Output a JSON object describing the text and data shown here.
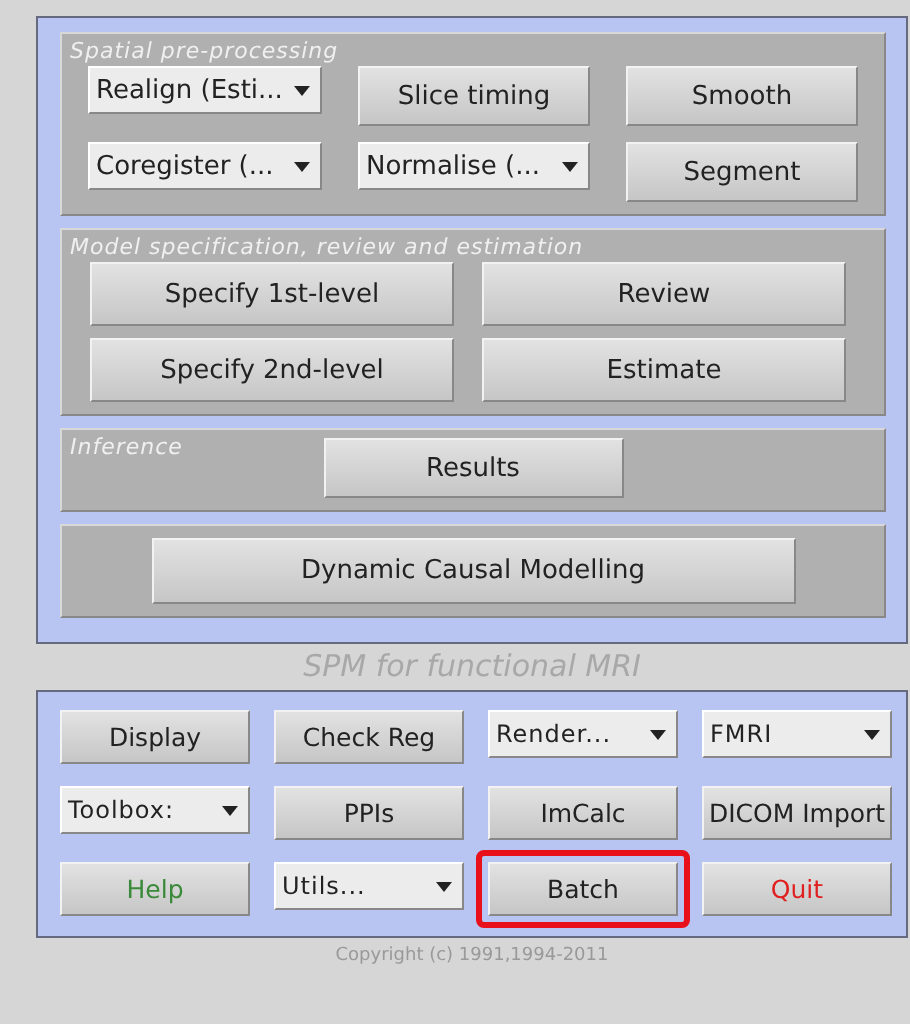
{
  "sections": [
    {
      "title": "Spatial pre-processing",
      "controls": [
        {
          "kind": "dropdown",
          "label": "Realign (Esti..."
        },
        {
          "kind": "button",
          "label": "Slice timing"
        },
        {
          "kind": "button",
          "label": "Smooth"
        },
        {
          "kind": "dropdown",
          "label": "Coregister (..."
        },
        {
          "kind": "dropdown",
          "label": "Normalise (..."
        },
        {
          "kind": "button",
          "label": "Segment"
        }
      ]
    },
    {
      "title": "Model specification, review and estimation",
      "controls": [
        {
          "kind": "button",
          "label": "Specify 1st-level"
        },
        {
          "kind": "button",
          "label": "Review"
        },
        {
          "kind": "button",
          "label": "Specify 2nd-level"
        },
        {
          "kind": "button",
          "label": "Estimate"
        }
      ]
    },
    {
      "title": "Inference",
      "controls": [
        {
          "kind": "button",
          "label": "Results"
        }
      ]
    },
    {
      "controls": [
        {
          "kind": "button",
          "label": "Dynamic Causal Modelling"
        }
      ]
    }
  ],
  "app_title": "SPM for functional MRI",
  "tools": [
    {
      "kind": "button",
      "label": "Display"
    },
    {
      "kind": "button",
      "label": "Check Reg"
    },
    {
      "kind": "dropdown",
      "label": "Render..."
    },
    {
      "kind": "dropdown",
      "label": "FMRI"
    },
    {
      "kind": "dropdown",
      "label": "Toolbox:"
    },
    {
      "kind": "button",
      "label": "PPIs"
    },
    {
      "kind": "button",
      "label": "ImCalc"
    },
    {
      "kind": "button",
      "label": "DICOM Import"
    },
    {
      "kind": "button",
      "label": "Help",
      "color": "#3a8a3a"
    },
    {
      "kind": "dropdown",
      "label": "Utils..."
    },
    {
      "kind": "button",
      "label": "Batch",
      "highlighted": true
    },
    {
      "kind": "button",
      "label": "Quit",
      "color": "#e02020"
    }
  ],
  "copyright": "Copyright (c) 1991,1994-2011"
}
